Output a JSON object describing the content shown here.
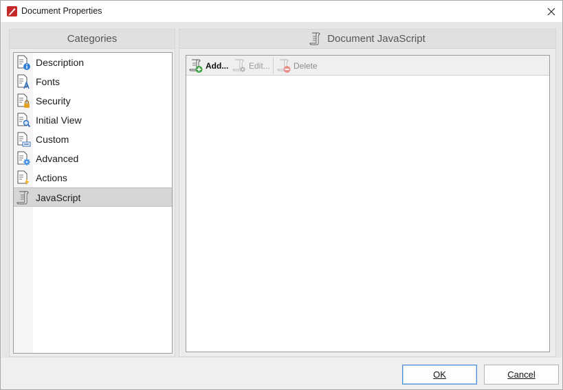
{
  "window": {
    "title": "Document Properties",
    "accent": "#c62828"
  },
  "categories_panel": {
    "header": "Categories",
    "items": [
      {
        "label": "Description",
        "icon": "document-info-icon",
        "selected": false
      },
      {
        "label": "Fonts",
        "icon": "document-font-icon",
        "selected": false
      },
      {
        "label": "Security",
        "icon": "document-lock-icon",
        "selected": false
      },
      {
        "label": "Initial View",
        "icon": "document-magnifier-icon",
        "selected": false
      },
      {
        "label": "Custom",
        "icon": "document-custom-icon",
        "selected": false
      },
      {
        "label": "Advanced",
        "icon": "document-gear-icon",
        "selected": false
      },
      {
        "label": "Actions",
        "icon": "document-lightning-icon",
        "selected": false
      },
      {
        "label": "JavaScript",
        "icon": "scroll-icon",
        "selected": true
      }
    ]
  },
  "javascript_panel": {
    "header": "Document JavaScript",
    "toolbar": {
      "add_label": "Add...",
      "edit_label": "Edit...",
      "delete_label": "Delete"
    }
  },
  "footer": {
    "ok_label": "OK",
    "cancel_label": "Cancel"
  }
}
